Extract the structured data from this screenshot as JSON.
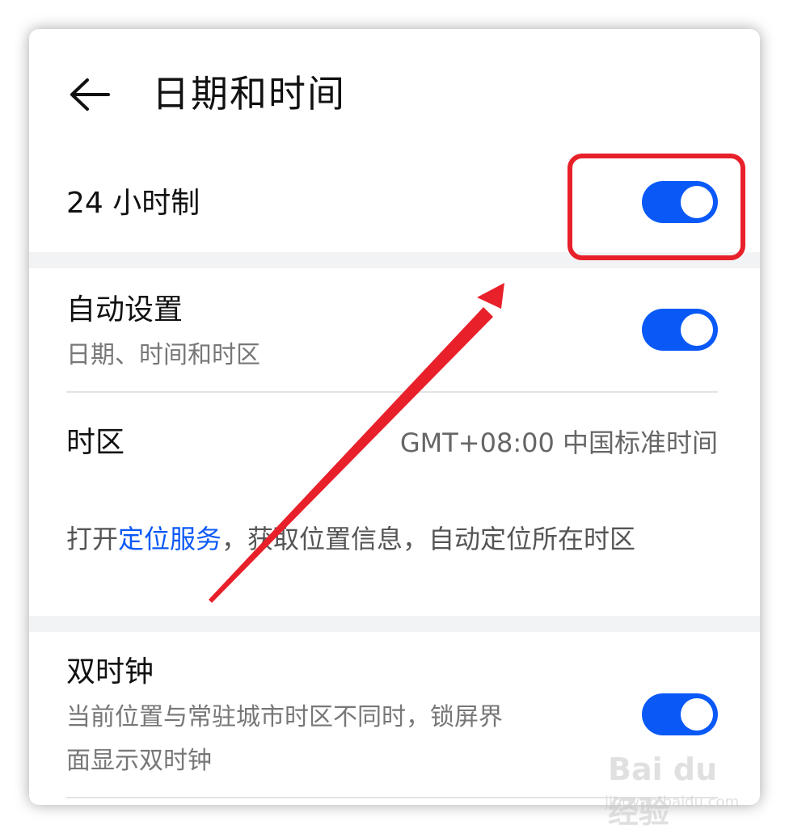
{
  "header": {
    "title": "日期和时间",
    "back_icon": "arrow-left-icon"
  },
  "settings": {
    "hour24": {
      "label": "24 小时制",
      "enabled": true
    },
    "auto_set": {
      "label": "自动设置",
      "sublabel": "日期、时间和时区",
      "enabled": true
    },
    "timezone": {
      "label": "时区",
      "value": "GMT+08:00 中国标准时间"
    },
    "location_note": {
      "prefix": "打开",
      "link": "定位服务",
      "suffix": "，获取位置信息，自动定位所在时区"
    },
    "dual_clock": {
      "label": "双时钟",
      "sublabel_line1": "当前位置与常驻城市时区不同时，锁屏界",
      "sublabel_line2": "面显示双时钟",
      "enabled": true
    }
  },
  "annotation": {
    "highlight_color": "#e8202a"
  },
  "watermark": {
    "logo_text": "Bai du 经验",
    "url": "jingyan.baidu.com"
  },
  "colors": {
    "accent": "#0a59f7",
    "section_gap": "#f1f3f5"
  }
}
